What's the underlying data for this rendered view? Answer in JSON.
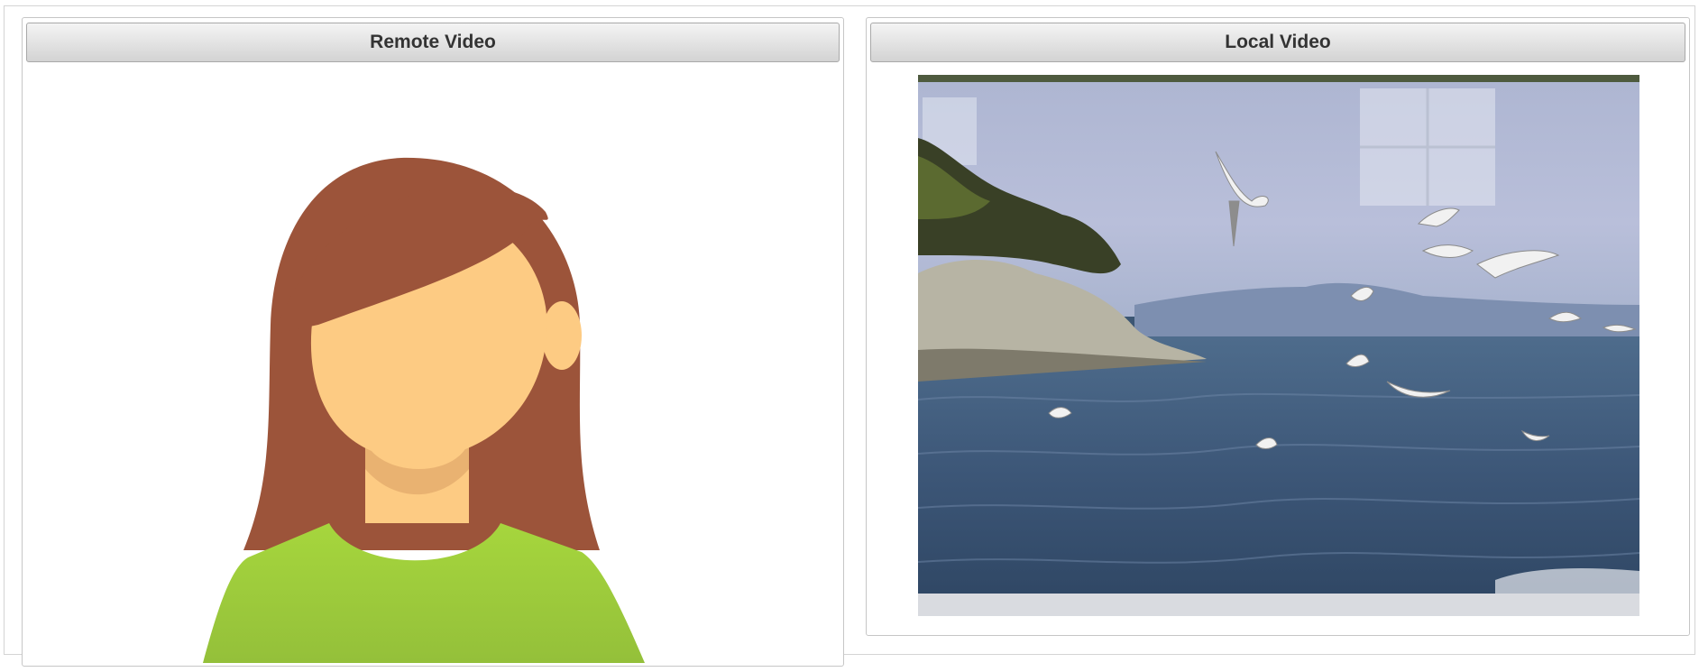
{
  "remote_video": {
    "title": "Remote Video",
    "placeholder_icon": "female-avatar-placeholder"
  },
  "local_video": {
    "title": "Local Video",
    "feed_description_icon": "webcam-feed"
  },
  "colors": {
    "hair": "#9c543a",
    "skin": "#fdcb83",
    "skin_shadow": "#e9b271",
    "shirt_top": "#a6d63d",
    "shirt_bottom": "#94c03a",
    "header_top": "#f4f4f4",
    "header_bottom": "#d3d3d3",
    "title_text": "#333333"
  }
}
